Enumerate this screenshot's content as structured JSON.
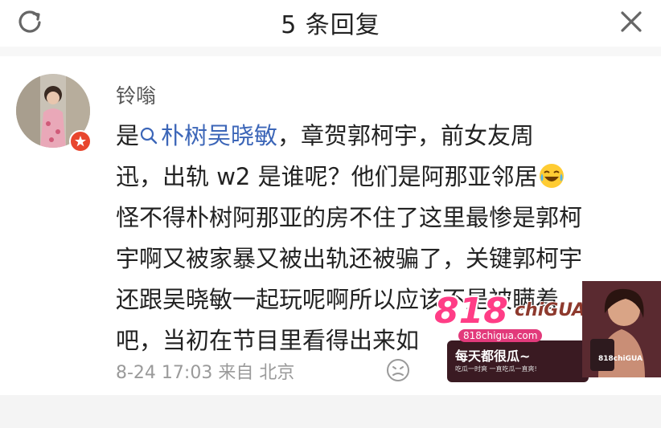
{
  "header": {
    "title": "5 条回复",
    "refresh_icon": "refresh-icon",
    "close_icon": "close-icon"
  },
  "comment": {
    "username": "铃嗡",
    "topic": "朴树吴晓敏",
    "lines": [
      "，章贺郭柯宇，前女友周",
      "迅，出轨 w2 是谁呢？他们是阿那亚邻居",
      "怪不得朴树阿那亚的房不住了这里最惨是郭柯",
      "宇啊又被家暴又被出轨还被骗了，关键郭柯宇",
      "还跟吴晓敏一起玩呢啊所以应该不是被瞒着",
      "吧，当初在节目里看得出来如"
    ],
    "prefix": "是",
    "timestamp": "8-24 17:03",
    "from_label": "来自",
    "location": "北京",
    "emoji": "laugh-cry-emoji"
  },
  "watermark": {
    "brand": "818",
    "brand_suffix": "chiGUA",
    "site": "818chigua.com",
    "slogan": "每天都很瓜~",
    "sub": "吃瓜一时爽 一直吃瓜一直爽!",
    "tag": "818chiGUA"
  },
  "colors": {
    "topic": "#3c66b8",
    "badge": "#e8462e",
    "meta": "#9a9a9a"
  }
}
